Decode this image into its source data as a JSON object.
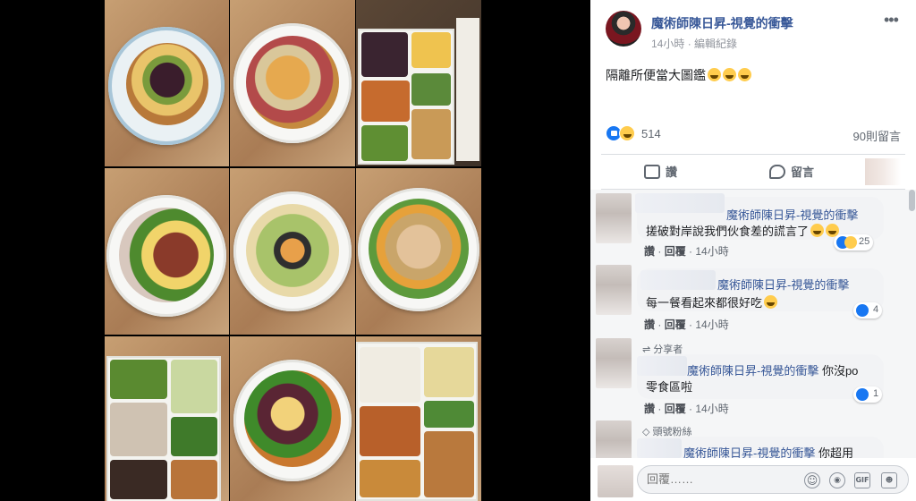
{
  "post": {
    "author": "魔術師陳日昇-視覺的衝擊",
    "time": "14小時",
    "edited": "編輯紀錄",
    "text": "隔離所便當大圖鑑",
    "reaction_count": "514",
    "comment_count": "90則留言"
  },
  "actions": {
    "like": "讚",
    "comment": "留言"
  },
  "comments": [
    {
      "badge": "",
      "name": "魔術師陳日昇-視覺的衝擊",
      "text": "搓破對岸說我們伙食差的謊言了",
      "like_label": "讚",
      "reply_label": "回覆",
      "time": "14小時",
      "reactions": "25"
    },
    {
      "badge": "",
      "name": "魔術師陳日昇-視覺的衝擊",
      "text": "每一餐看起來都很好吃",
      "like_label": "讚",
      "reply_label": "回覆",
      "time": "14小時",
      "reactions": "4"
    },
    {
      "badge": "分享者",
      "name": "魔術師陳日昇-視覺的衝擊",
      "name_suffix": " 你沒po",
      "text": "零食區啦",
      "like_label": "讚",
      "reply_label": "回覆",
      "time": "14小時",
      "reactions": "1"
    },
    {
      "badge": "頭號粉絲",
      "name": "魔術師陳日昇-視覺的衝擊",
      "name_suffix": " 你超用"
    }
  ],
  "reply": {
    "placeholder": "回覆……"
  },
  "icons": {
    "more": "more-dots-icon",
    "like": "thumbs-up-icon",
    "comment": "comment-bubble-icon",
    "camera": "camera-icon",
    "gif": "gif-icon",
    "sticker": "sticker-icon",
    "emoji": "emoji-icon"
  },
  "colors": {
    "link": "#385898",
    "like_blue": "#1877f2",
    "haha_yellow": "#ffcc4d"
  }
}
